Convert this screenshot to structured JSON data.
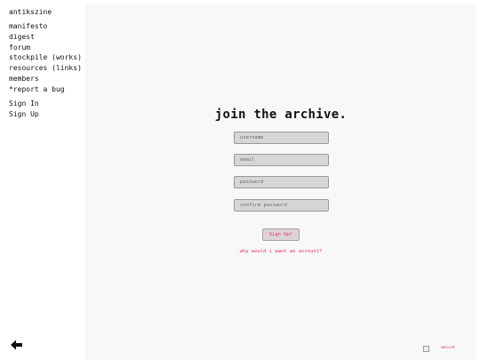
{
  "site": {
    "title": "antikszine"
  },
  "nav": {
    "items": [
      "manifesto",
      "digest",
      "forum",
      "stockpile (works)",
      "resources (links)",
      "members",
      "*report a bug"
    ]
  },
  "auth": {
    "sign_in": "Sign In",
    "sign_up": "Sign Up"
  },
  "back": {
    "icon": "arrow-left-icon"
  },
  "form": {
    "heading": "join the archive.",
    "username_placeholder": "username",
    "email_placeholder": "email",
    "password_placeholder": "password",
    "confirm_placeholder": "confirm password",
    "submit_label": "Sign Up!",
    "why_link": "why would i want an account?"
  },
  "footer": {
    "mascot_alt": "mascot",
    "broken_image_icon": "broken-image-icon"
  },
  "colors": {
    "accent": "#e0306e",
    "panel": "#f8f8f8",
    "input": "#d6d6d6"
  }
}
